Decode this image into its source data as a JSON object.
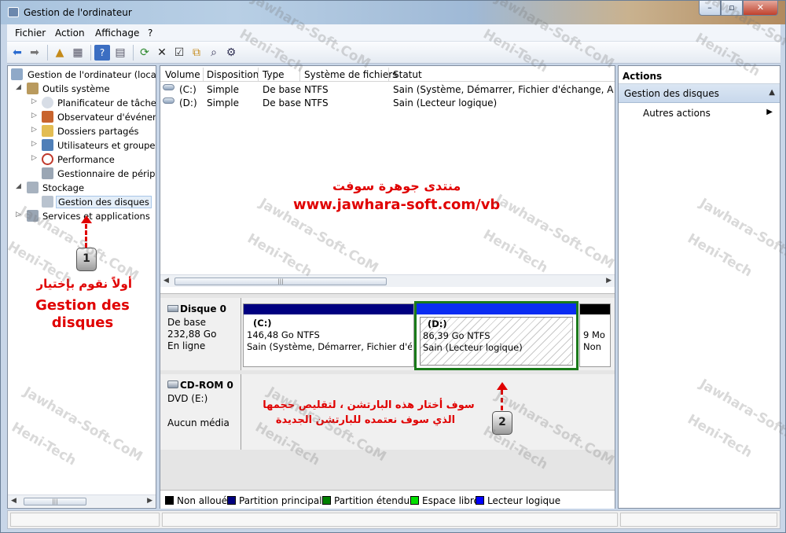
{
  "window": {
    "title": "Gestion de l'ordinateur",
    "min": "–",
    "max": "▫",
    "close": "✕"
  },
  "menu": [
    "Fichier",
    "Action",
    "Affichage",
    "?"
  ],
  "tree": {
    "items": [
      {
        "label": "Gestion de l'ordinateur (local)",
        "arrow": ""
      },
      {
        "label": "Outils système",
        "arrow": "◢"
      },
      {
        "label": "Planificateur de tâches",
        "arrow": "▷"
      },
      {
        "label": "Observateur d'événeme",
        "arrow": "▷"
      },
      {
        "label": "Dossiers partagés",
        "arrow": "▷"
      },
      {
        "label": "Utilisateurs et groupes l",
        "arrow": "▷"
      },
      {
        "label": "Performance",
        "arrow": "▷"
      },
      {
        "label": "Gestionnaire de périphé",
        "arrow": ""
      },
      {
        "label": "Stockage",
        "arrow": "◢"
      },
      {
        "label": "Gestion des disques",
        "arrow": ""
      },
      {
        "label": "Services et applications",
        "arrow": "▷"
      }
    ]
  },
  "volumes": {
    "columns": [
      "Volume",
      "Disposition",
      "Type",
      "Système de fichiers",
      "Statut"
    ],
    "rows": [
      {
        "volume": "(C:)",
        "disposition": "Simple",
        "type": "De base",
        "fs": "NTFS",
        "status": "Sain (Système, Démarrer, Fichier d'échange, Actif, Vid"
      },
      {
        "volume": "(D:)",
        "disposition": "Simple",
        "type": "De base",
        "fs": "NTFS",
        "status": "Sain (Lecteur logique)"
      }
    ]
  },
  "disk0": {
    "name": "Disque 0",
    "type": "De base",
    "size": "232,88 Go",
    "state": "En ligne",
    "partitions": [
      {
        "letter": "(C:)",
        "size": "146,48 Go NTFS",
        "status": "Sain (Système, Démarrer, Fichier d'éch"
      },
      {
        "letter": "(D:)",
        "size": "86,39 Go NTFS",
        "status": "Sain (Lecteur logique)"
      },
      {
        "letter": "",
        "size": "9 Mo",
        "status": "Non"
      }
    ]
  },
  "cdrom0": {
    "name": "CD-ROM 0",
    "drive": "DVD (E:)",
    "media": "Aucun média"
  },
  "legend": [
    {
      "label": "Non alloué",
      "color": "#000000"
    },
    {
      "label": "Partition principale",
      "color": "#000080"
    },
    {
      "label": "Partition étendue",
      "color": "#008000"
    },
    {
      "label": "Espace libre",
      "color": "#00e000"
    },
    {
      "label": "Lecteur logique",
      "color": "#0000ff"
    }
  ],
  "actions": {
    "title": "Actions",
    "group": "Gestion des disques",
    "item": "Autres actions"
  },
  "annotations": {
    "forum_arabic": "منتدى جوهرة سوفت",
    "url": "www.jawhara-soft.com/vb",
    "step1_arabic": "أولاً نقوم بإختيار",
    "step1_label": "Gestion des disques",
    "step2_line1": "سوف أختار هذه البارتشن ، لتقليص حجمها",
    "step2_line2": "الذي سوف نعتمده للبارتشن الجديدة",
    "key1": "1",
    "key2": "2"
  },
  "watermark": {
    "line1": "Jawhara-Soft.CoM",
    "line2": "Heni-Tech"
  },
  "colors": {
    "accent_red": "#e00000",
    "primary_partition": "#000080",
    "logical_drive": "#0000ff",
    "extended_partition": "#008000"
  }
}
